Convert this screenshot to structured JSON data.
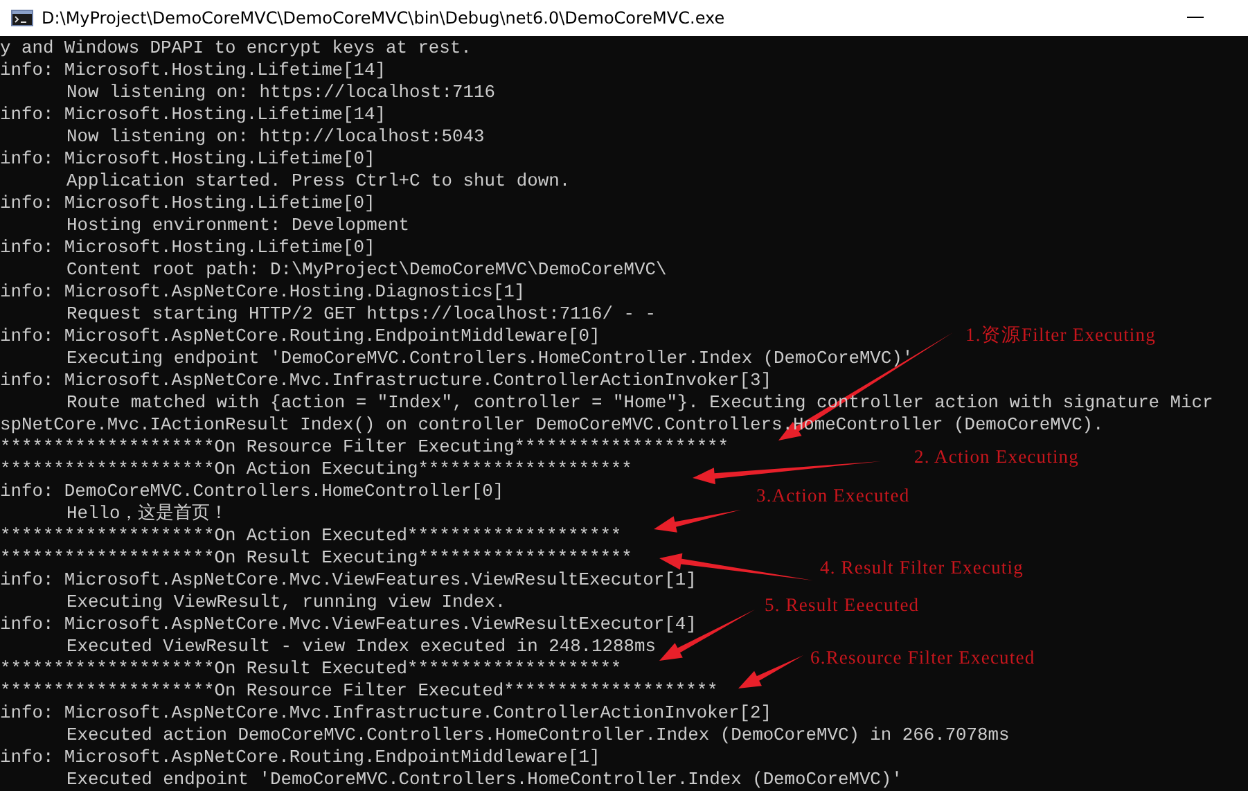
{
  "window": {
    "title": "D:\\MyProject\\DemoCoreMVC\\DemoCoreMVC\\bin\\Debug\\net6.0\\DemoCoreMVC.exe"
  },
  "console": {
    "lines": [
      {
        "kind": "plain",
        "text": "y and Windows DPAPI to encrypt keys at rest."
      },
      {
        "kind": "header",
        "text": "info: Microsoft.Hosting.Lifetime[14]"
      },
      {
        "kind": "message",
        "text": "Now listening on: https://localhost:7116"
      },
      {
        "kind": "header",
        "text": "info: Microsoft.Hosting.Lifetime[14]"
      },
      {
        "kind": "message",
        "text": "Now listening on: http://localhost:5043"
      },
      {
        "kind": "header",
        "text": "info: Microsoft.Hosting.Lifetime[0]"
      },
      {
        "kind": "message",
        "text": "Application started. Press Ctrl+C to shut down."
      },
      {
        "kind": "header",
        "text": "info: Microsoft.Hosting.Lifetime[0]"
      },
      {
        "kind": "message",
        "text": "Hosting environment: Development"
      },
      {
        "kind": "header",
        "text": "info: Microsoft.Hosting.Lifetime[0]"
      },
      {
        "kind": "message",
        "text": "Content root path: D:\\MyProject\\DemoCoreMVC\\DemoCoreMVC\\"
      },
      {
        "kind": "header",
        "text": "info: Microsoft.AspNetCore.Hosting.Diagnostics[1]"
      },
      {
        "kind": "message",
        "text": "Request starting HTTP/2 GET https://localhost:7116/ - -"
      },
      {
        "kind": "header",
        "text": "info: Microsoft.AspNetCore.Routing.EndpointMiddleware[0]"
      },
      {
        "kind": "message",
        "text": "Executing endpoint 'DemoCoreMVC.Controllers.HomeController.Index (DemoCoreMVC)'"
      },
      {
        "kind": "header",
        "text": "info: Microsoft.AspNetCore.Mvc.Infrastructure.ControllerActionInvoker[3]"
      },
      {
        "kind": "message",
        "text": "Route matched with {action = \"Index\", controller = \"Home\"}. Executing controller action with signature Micr"
      },
      {
        "kind": "plain",
        "text": "spNetCore.Mvc.IActionResult Index() on controller DemoCoreMVC.Controllers.HomeController (DemoCoreMVC)."
      },
      {
        "kind": "plain",
        "text": "********************On Resource Filter Executing********************"
      },
      {
        "kind": "plain",
        "text": "********************On Action Executing********************"
      },
      {
        "kind": "header",
        "text": "info: DemoCoreMVC.Controllers.HomeController[0]"
      },
      {
        "kind": "message",
        "text": "Hello，这是首页！"
      },
      {
        "kind": "plain",
        "text": "********************On Action Executed********************"
      },
      {
        "kind": "plain",
        "text": "********************On Result Executing********************"
      },
      {
        "kind": "header",
        "text": "info: Microsoft.AspNetCore.Mvc.ViewFeatures.ViewResultExecutor[1]"
      },
      {
        "kind": "message",
        "text": "Executing ViewResult, running view Index."
      },
      {
        "kind": "header",
        "text": "info: Microsoft.AspNetCore.Mvc.ViewFeatures.ViewResultExecutor[4]"
      },
      {
        "kind": "message",
        "text": "Executed ViewResult - view Index executed in 248.1288ms"
      },
      {
        "kind": "plain",
        "text": "********************On Result Executed********************"
      },
      {
        "kind": "plain",
        "text": "********************On Resource Filter Executed********************"
      },
      {
        "kind": "header",
        "text": "info: Microsoft.AspNetCore.Mvc.Infrastructure.ControllerActionInvoker[2]"
      },
      {
        "kind": "message",
        "text": "Executed action DemoCoreMVC.Controllers.HomeController.Index (DemoCoreMVC) in 266.7078ms"
      },
      {
        "kind": "header",
        "text": "info: Microsoft.AspNetCore.Routing.EndpointMiddleware[1]"
      },
      {
        "kind": "message",
        "text": "Executed endpoint 'DemoCoreMVC.Controllers.HomeController.Index (DemoCoreMVC)'"
      }
    ]
  },
  "annotations": [
    {
      "text": "1.资源Filter Executing"
    },
    {
      "text": "2. Action Executing"
    },
    {
      "text": "3.Action Executed"
    },
    {
      "text": "4. Result Filter Executig"
    },
    {
      "text": "5. Result Eeecuted"
    },
    {
      "text": "6.Resource Filter Executed"
    }
  ]
}
